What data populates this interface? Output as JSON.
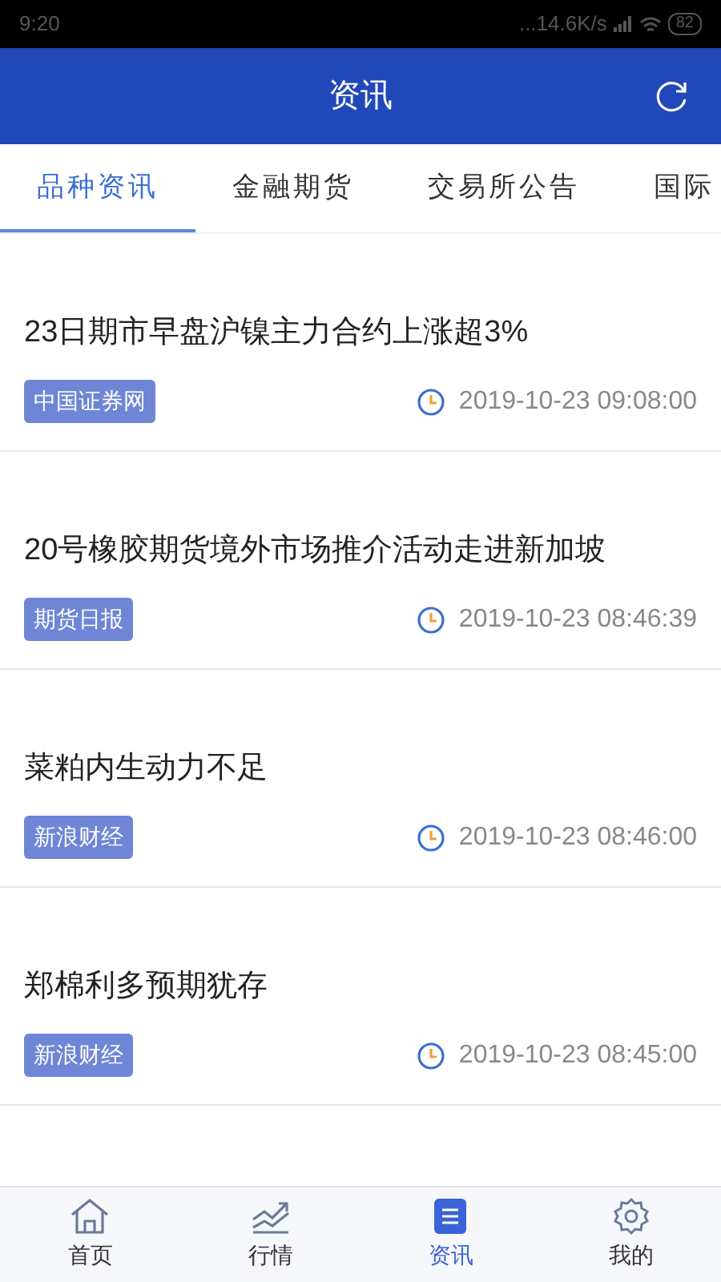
{
  "status_bar": {
    "time": "9:20",
    "network_speed": "...14.6K/s",
    "battery": "82"
  },
  "header": {
    "title": "资讯"
  },
  "tabs": [
    {
      "label": "品种资讯",
      "selected": true
    },
    {
      "label": "金融期货",
      "selected": false
    },
    {
      "label": "交易所公告",
      "selected": false
    },
    {
      "label": "国际",
      "selected": false
    }
  ],
  "news": [
    {
      "title": "23日期市早盘沪镍主力合约上涨超3%",
      "source": "中国证券网",
      "time": "2019-10-23 09:08:00"
    },
    {
      "title": "20号橡胶期货境外市场推介活动走进新加坡",
      "source": "期货日报",
      "time": "2019-10-23 08:46:39"
    },
    {
      "title": "菜粕内生动力不足",
      "source": "新浪财经",
      "time": "2019-10-23 08:46:00"
    },
    {
      "title": "郑棉利多预期犹存",
      "source": "新浪财经",
      "time": "2019-10-23 08:45:00"
    }
  ],
  "bottom_nav": [
    {
      "kind": "home",
      "label": "首页",
      "selected": false
    },
    {
      "kind": "market",
      "label": "行情",
      "selected": false
    },
    {
      "kind": "news",
      "label": "资讯",
      "selected": true
    },
    {
      "kind": "profile",
      "label": "我的",
      "selected": false
    }
  ]
}
